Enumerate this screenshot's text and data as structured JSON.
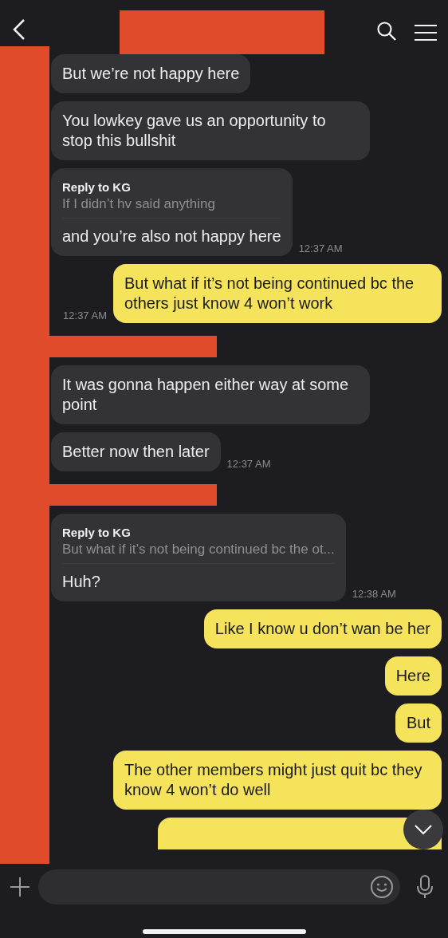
{
  "header": {
    "redacted": true
  },
  "messages": [
    {
      "kind": "incoming",
      "text": "But we’re not happy here"
    },
    {
      "kind": "incoming",
      "text": "You lowkey gave us an opportunity to stop this bullshit"
    },
    {
      "kind": "incoming",
      "reply": {
        "label": "Reply to KG",
        "quote": "If I didn’t hv said anything"
      },
      "text": "and you’re also not happy here",
      "time": "12:37 AM"
    },
    {
      "kind": "outgoing",
      "text": "But what if it’s not being continued bc the others just know 4 won’t work",
      "time": "12:37 AM"
    },
    {
      "kind": "redaction"
    },
    {
      "kind": "incoming",
      "text": "It was gonna happen either way at some point"
    },
    {
      "kind": "incoming",
      "text": "Better now then later",
      "time": "12:37 AM"
    },
    {
      "kind": "redaction"
    },
    {
      "kind": "incoming",
      "reply": {
        "label": "Reply to KG",
        "quote": "But what if it’s not being continued bc the ot..."
      },
      "text": "Huh?",
      "time": "12:38 AM"
    },
    {
      "kind": "outgoing",
      "text": "Like I know u don’t wan be her"
    },
    {
      "kind": "outgoing",
      "text": "Here"
    },
    {
      "kind": "outgoing",
      "text": "But"
    },
    {
      "kind": "outgoing",
      "text": "The other members might just quit bc they know 4 won’t do well"
    },
    {
      "kind": "partial"
    }
  ]
}
